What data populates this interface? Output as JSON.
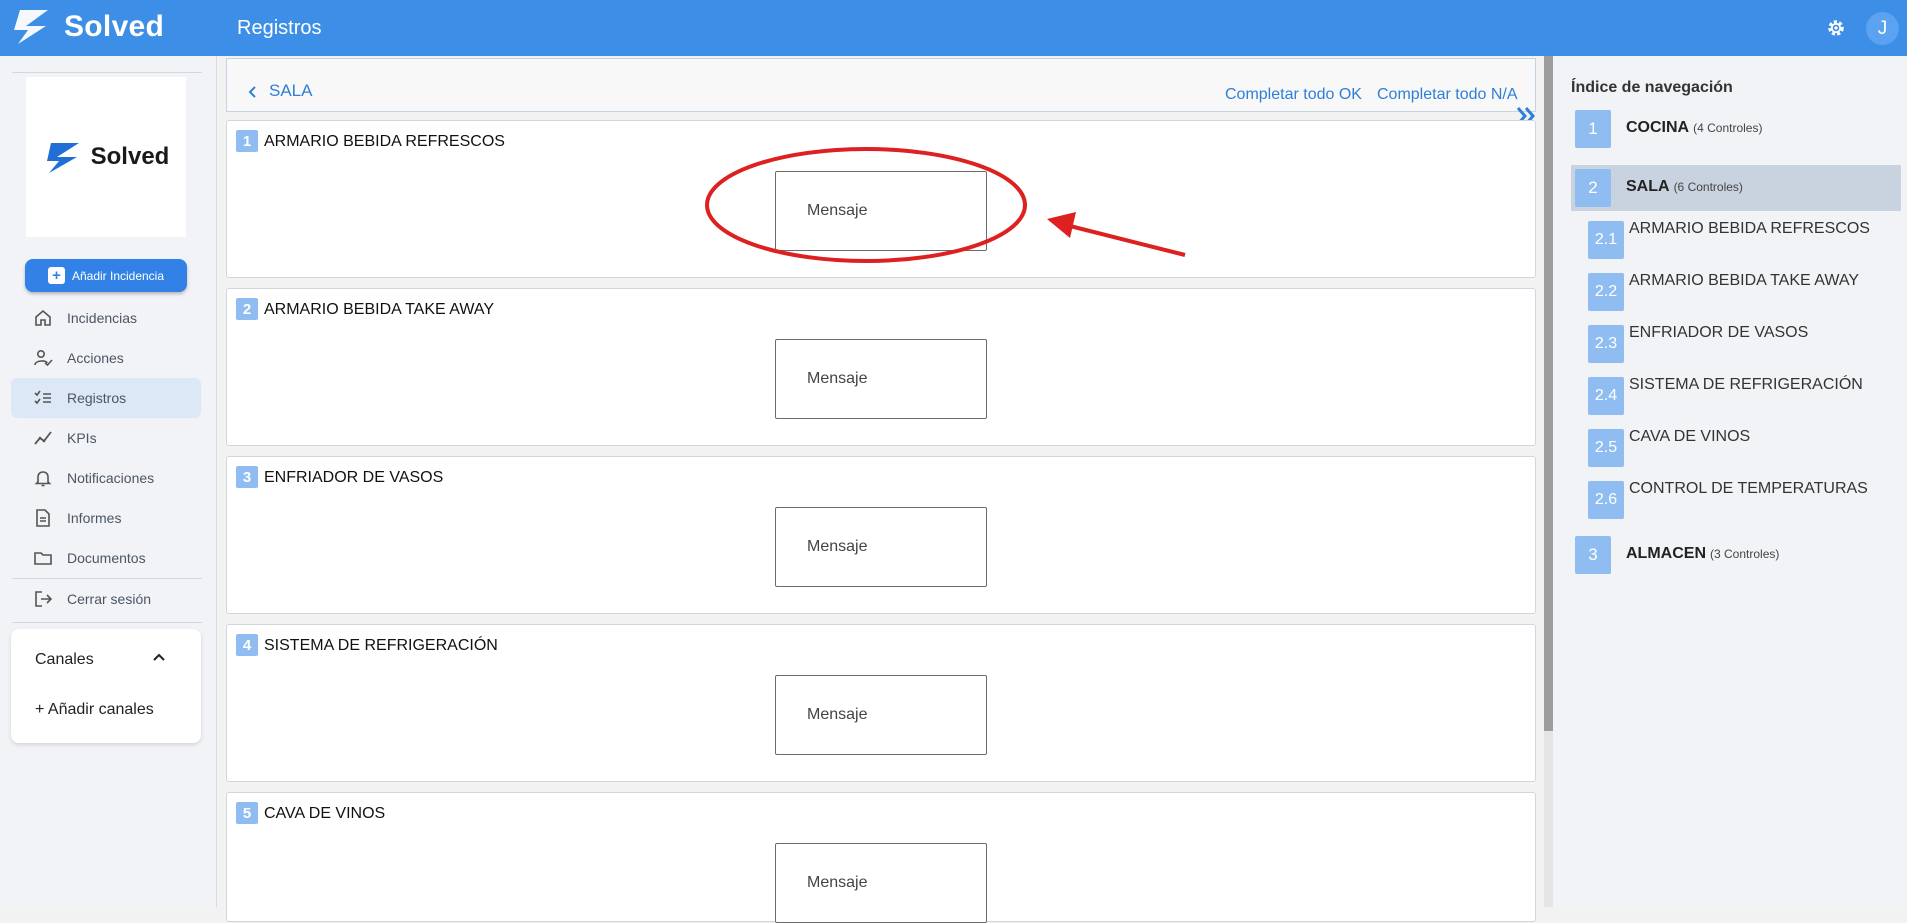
{
  "app": {
    "brand": "Solved",
    "page_title": "Registros",
    "user_initial": "J"
  },
  "sidebar": {
    "logo_text": "Solved",
    "add_button": "Añadir Incidencia",
    "items": [
      {
        "label": "Incidencias",
        "icon": "home-icon"
      },
      {
        "label": "Acciones",
        "icon": "user-check-icon"
      },
      {
        "label": "Registros",
        "icon": "checklist-icon",
        "active": true
      },
      {
        "label": "KPIs",
        "icon": "chart-line-icon"
      },
      {
        "label": "Notificaciones",
        "icon": "bell-icon"
      },
      {
        "label": "Informes",
        "icon": "document-icon"
      },
      {
        "label": "Documentos",
        "icon": "folder-icon"
      }
    ],
    "logout": "Cerrar sesión",
    "channels": {
      "title": "Canales",
      "add": "+ Añadir canales"
    }
  },
  "main": {
    "section": "SALA",
    "complete_ok": "Completar todo OK",
    "complete_na": "Completar todo N/A",
    "items": [
      {
        "num": "1",
        "title": "ARMARIO BEBIDA REFRESCOS",
        "button": "Mensaje"
      },
      {
        "num": "2",
        "title": "ARMARIO BEBIDA TAKE AWAY",
        "button": "Mensaje"
      },
      {
        "num": "3",
        "title": "ENFRIADOR DE VASOS",
        "button": "Mensaje"
      },
      {
        "num": "4",
        "title": "SISTEMA DE REFRIGERACIÓN",
        "button": "Mensaje"
      },
      {
        "num": "5",
        "title": "CAVA DE VINOS",
        "button": "Mensaje"
      }
    ]
  },
  "index": {
    "title": "Índice de navegación",
    "sections": [
      {
        "num": "1",
        "name": "COCINA",
        "count": "(4 Controles)"
      },
      {
        "num": "2",
        "name": "SALA",
        "count": "(6 Controles)",
        "active": true
      },
      {
        "num": "3",
        "name": "ALMACEN",
        "count": "(3 Controles)"
      }
    ],
    "subitems": [
      {
        "num": "2.1",
        "name": "ARMARIO BEBIDA REFRESCOS"
      },
      {
        "num": "2.2",
        "name": "ARMARIO BEBIDA TAKE AWAY"
      },
      {
        "num": "2.3",
        "name": "ENFRIADOR DE VASOS"
      },
      {
        "num": "2.4",
        "name": "SISTEMA DE REFRIGERACIÓN"
      },
      {
        "num": "2.5",
        "name": "CAVA DE VINOS"
      },
      {
        "num": "2.6",
        "name": "CONTROL DE TEMPERATURAS"
      }
    ]
  },
  "colors": {
    "primary": "#3c8ee6",
    "badge": "#8fbdf2",
    "annotation": "#dd2020"
  }
}
